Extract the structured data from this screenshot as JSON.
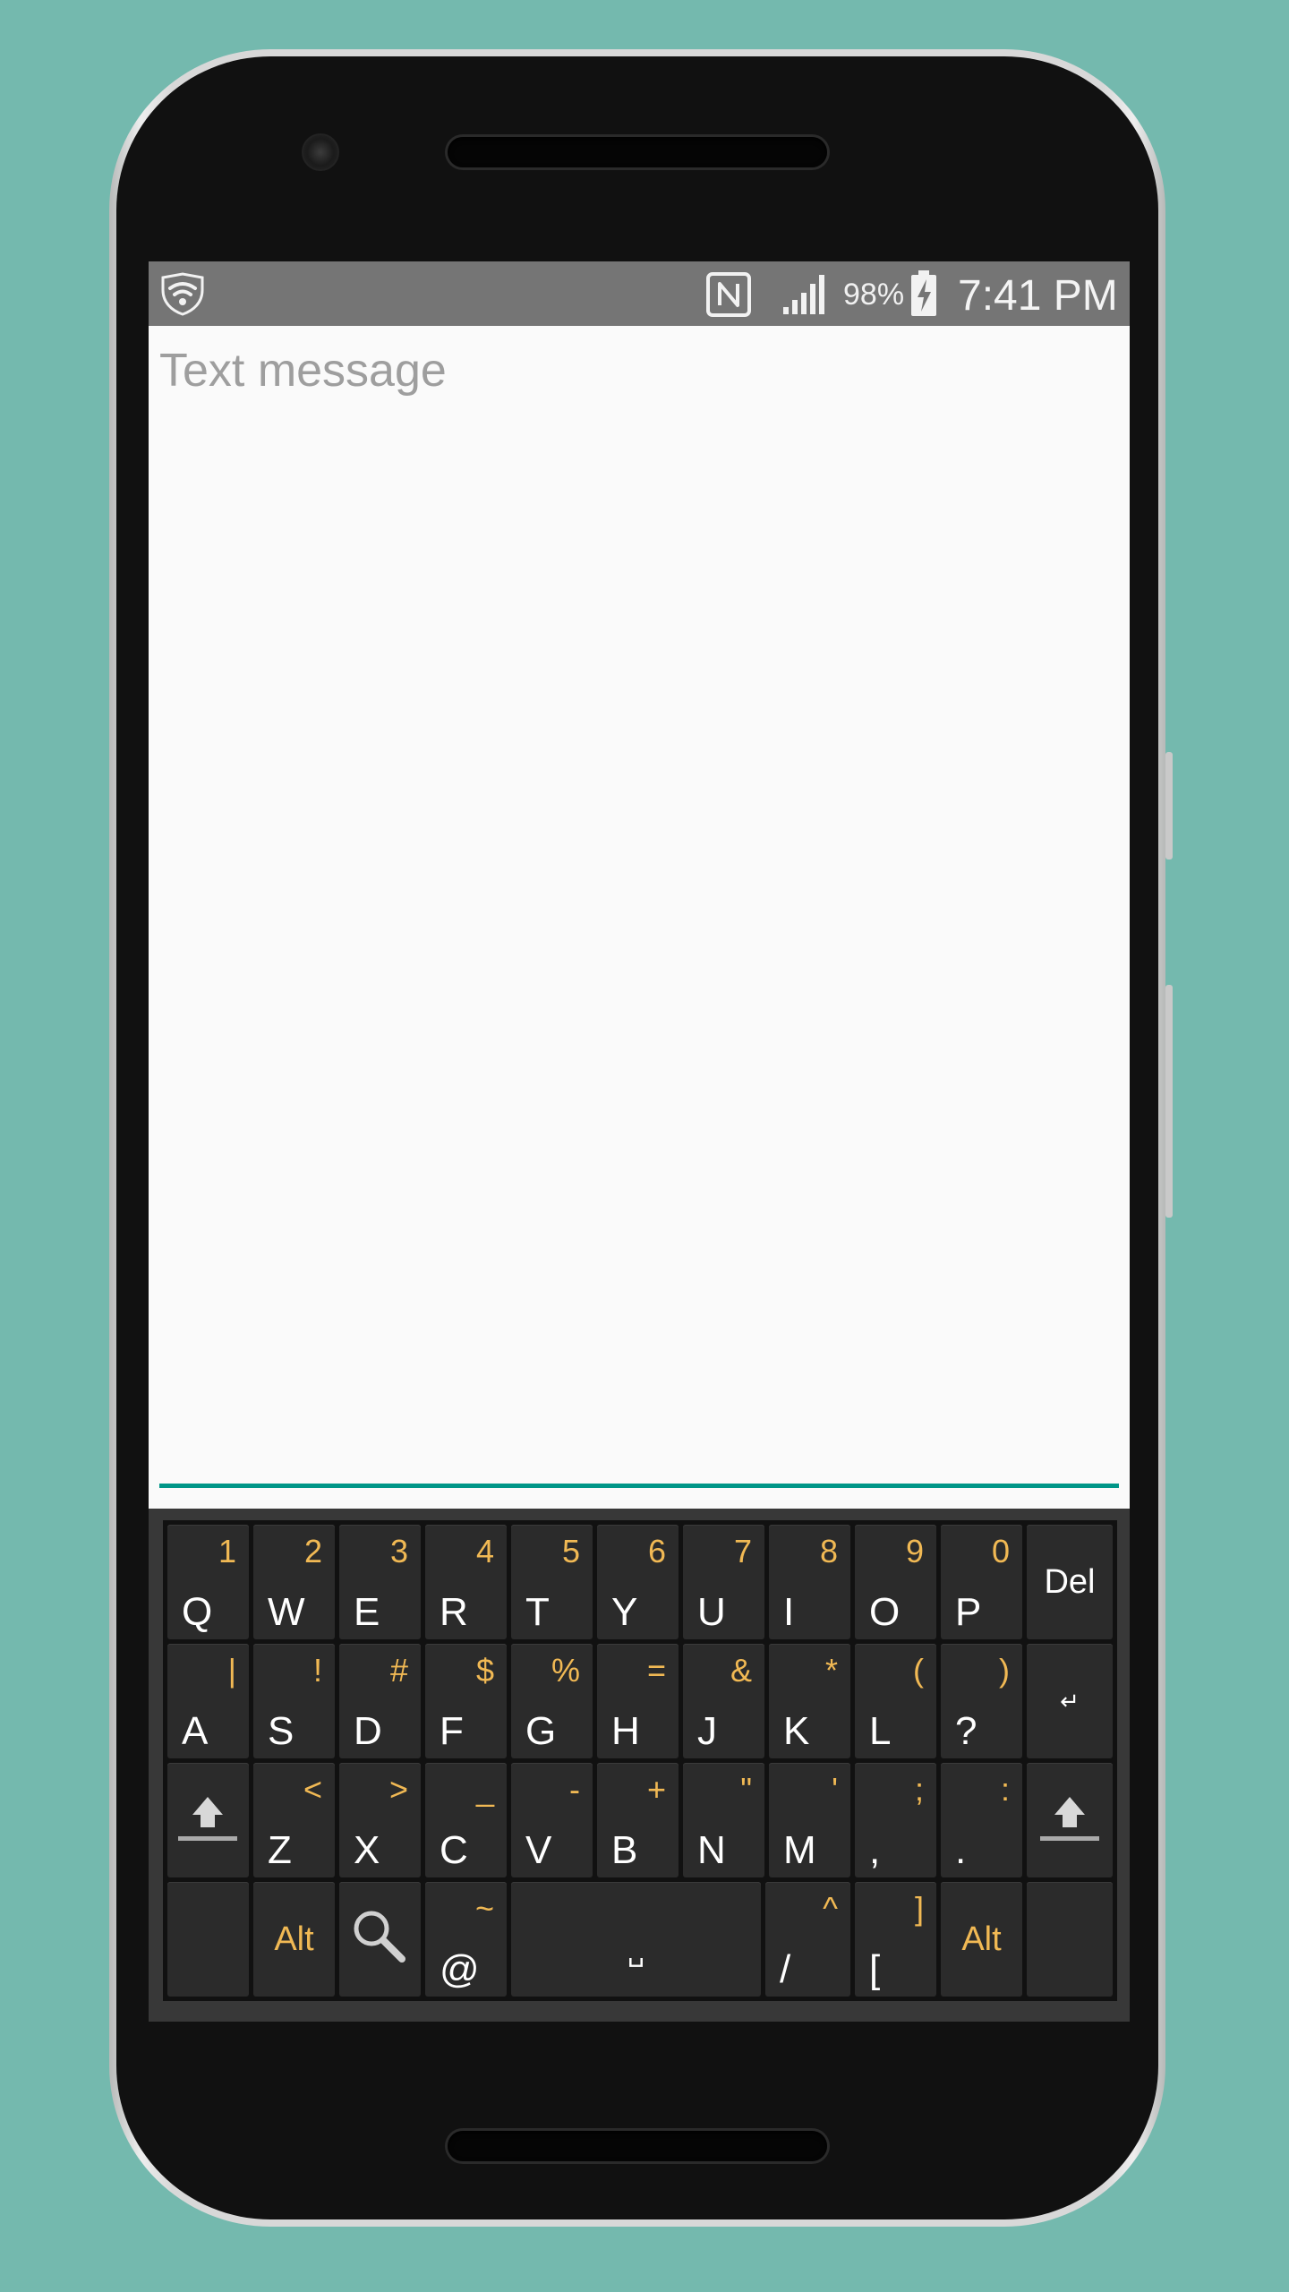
{
  "status_bar": {
    "battery_percent": "98%",
    "time": "7:41 PM",
    "icons": [
      "shield-wifi-icon",
      "nfc-icon",
      "signal-icon",
      "battery-charging-icon"
    ]
  },
  "message": {
    "placeholder": "Text message",
    "value": ""
  },
  "keyboard": {
    "row1": [
      {
        "primary": "Q",
        "secondary": "1"
      },
      {
        "primary": "W",
        "secondary": "2"
      },
      {
        "primary": "E",
        "secondary": "3"
      },
      {
        "primary": "R",
        "secondary": "4"
      },
      {
        "primary": "T",
        "secondary": "5"
      },
      {
        "primary": "Y",
        "secondary": "6"
      },
      {
        "primary": "U",
        "secondary": "7"
      },
      {
        "primary": "I",
        "secondary": "8"
      },
      {
        "primary": "O",
        "secondary": "9"
      },
      {
        "primary": "P",
        "secondary": "0"
      }
    ],
    "del_label": "Del",
    "row2": [
      {
        "primary": "A",
        "secondary": "|"
      },
      {
        "primary": "S",
        "secondary": "!"
      },
      {
        "primary": "D",
        "secondary": "#"
      },
      {
        "primary": "F",
        "secondary": "$"
      },
      {
        "primary": "G",
        "secondary": "%"
      },
      {
        "primary": "H",
        "secondary": "="
      },
      {
        "primary": "J",
        "secondary": "&"
      },
      {
        "primary": "K",
        "secondary": "*"
      },
      {
        "primary": "L",
        "secondary": "("
      },
      {
        "primary": "?",
        "secondary": ")"
      }
    ],
    "enter_label": "↵",
    "row3": [
      {
        "primary": "Z",
        "secondary": "<"
      },
      {
        "primary": "X",
        "secondary": ">"
      },
      {
        "primary": "C",
        "secondary": "_"
      },
      {
        "primary": "V",
        "secondary": "-"
      },
      {
        "primary": "B",
        "secondary": "+"
      },
      {
        "primary": "N",
        "secondary": "\""
      },
      {
        "primary": "M",
        "secondary": "'"
      },
      {
        "primary": ",",
        "secondary": ";"
      },
      {
        "primary": ".",
        "secondary": ":"
      }
    ],
    "alt_label": "Alt",
    "at_key": {
      "primary": "@",
      "secondary": "~"
    },
    "space_label": "␣",
    "slash_key": {
      "primary": "/",
      "secondary": "^"
    },
    "bracket_key": {
      "primary": "[",
      "secondary": "]"
    },
    "accent_color": "#f1b954"
  },
  "colors": {
    "background": "#74b9ae",
    "status_bar": "#757575",
    "input_underline": "#009688",
    "keyboard_bg": "#383838",
    "key_bg": "#2b2b2b"
  }
}
